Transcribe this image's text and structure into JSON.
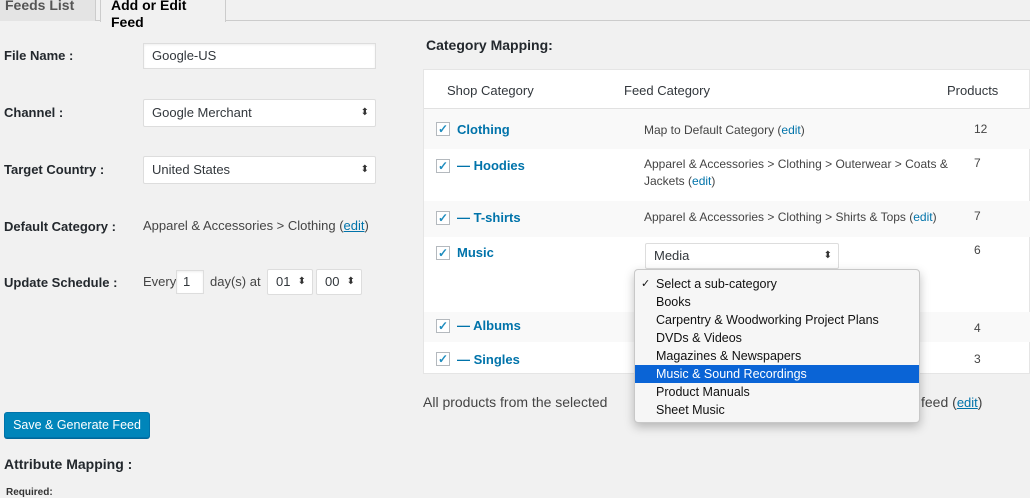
{
  "tabs": [
    "Feeds List",
    "Add or Edit Feed"
  ],
  "form": {
    "file_name_label": "File Name :",
    "file_name_value": "Google-US",
    "channel_label": "Channel :",
    "channel_value": "Google Merchant",
    "country_label": "Target Country :",
    "country_value": "United States",
    "default_category_label": "Default Category :",
    "default_category_value": "Apparel & Accessories > Clothing",
    "edit_link": "edit",
    "schedule_label": "Update Schedule :",
    "schedule_every": "Every",
    "schedule_days": "1",
    "schedule_days_at": "day(s) at",
    "schedule_hour": "01",
    "schedule_min": "00"
  },
  "category_mapping": {
    "title": "Category Mapping:",
    "headers": [
      "Shop Category",
      "Feed Category",
      "Products"
    ],
    "rows": [
      {
        "name": "Clothing",
        "feed_prefix": "Map to Default Category (",
        "edit": "edit",
        "feed_suffix": ")",
        "count": "12"
      },
      {
        "name": "— Hoodies",
        "feed_prefix": "Apparel & Accessories > Clothing > Outerwear > Coats & Jackets (",
        "edit": "edit",
        "feed_suffix": ")",
        "count": "7"
      },
      {
        "name": "— T-shirts",
        "feed_prefix": "Apparel & Accessories > Clothing > Shirts & Tops (",
        "edit": "edit",
        "feed_suffix": ")",
        "count": "7"
      },
      {
        "name": "Music",
        "feed_select": "Media",
        "count": "6"
      },
      {
        "name": "— Albums",
        "count": "4"
      },
      {
        "name": "— Singles",
        "count": "3"
      }
    ],
    "dropdown_options": [
      "Select a sub-category",
      "Books",
      "Carpentry & Woodworking Project Plans",
      "DVDs & Videos",
      "Magazines & Newspapers",
      "Music & Sound Recordings",
      "Product Manuals",
      "Sheet Music"
    ],
    "dropdown_checked_index": 0,
    "dropdown_highlighted_index": 5,
    "note_left": "All products from the selected",
    "note_right": "feed (",
    "note_edit": "edit",
    "note_suffix": ")"
  },
  "actions": {
    "save_button": "Save & Generate Feed"
  },
  "attribute_mapping": {
    "title": "Attribute Mapping :",
    "required_label": "Required:"
  },
  "colors": {
    "primary": "#0085ba",
    "link": "#0073aa",
    "highlight": "#0a64d6"
  }
}
